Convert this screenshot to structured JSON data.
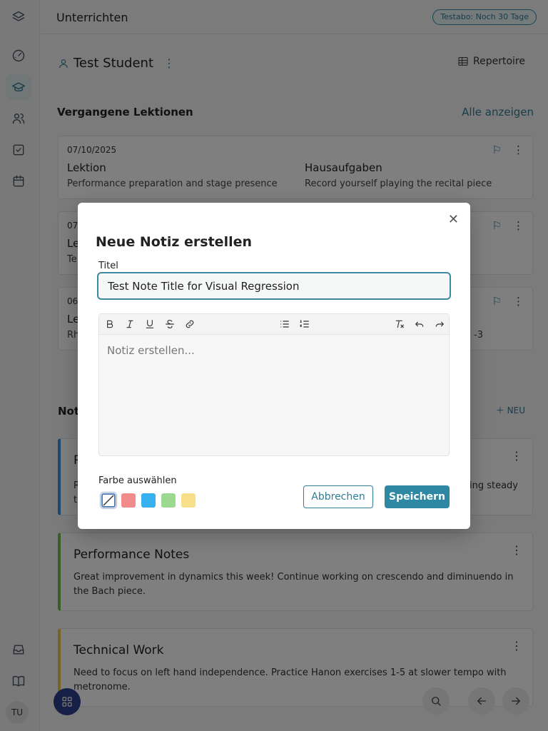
{
  "topbar": {
    "title": "Unterrichten",
    "trial_badge": "Testabo: Noch 30 Tage"
  },
  "sidebar": {
    "items": [
      {
        "icon": "layers-icon"
      },
      {
        "icon": "dashboard-icon"
      },
      {
        "icon": "graduation-cap-icon",
        "active": true
      },
      {
        "icon": "users-icon"
      },
      {
        "icon": "checkbox-icon"
      },
      {
        "icon": "calendar-icon"
      }
    ],
    "bottom": [
      {
        "icon": "inbox-icon"
      },
      {
        "icon": "book-icon"
      }
    ],
    "avatar": "TU"
  },
  "student": {
    "name": "Test Student",
    "repertoire_label": "Repertoire"
  },
  "past_lessons": {
    "title": "Vergangene Lektionen",
    "show_all": "Alle anzeigen",
    "cards": [
      {
        "date": "07/10/2025",
        "lesson_label": "Lektion",
        "lesson_text": "Performance preparation and stage presence",
        "homework_label": "Hausaufgaben",
        "homework_text": "Record yourself playing the recital piece"
      },
      {
        "date": "07/",
        "lesson_label": "Le",
        "lesson_text": "Te"
      },
      {
        "date": "06",
        "lesson_label": "Le",
        "lesson_text": "Rh",
        "homework_text": "-3"
      }
    ]
  },
  "notes": {
    "title": "Not",
    "new_label": "NEU",
    "items": [
      {
        "title": "P",
        "body_left": "R",
        "body_right": "ing steady",
        "body_line2": "t",
        "accent": "#3b8fd6"
      },
      {
        "title": "Performance Notes",
        "body": "Great improvement in dynamics this week! Continue working on crescendo and diminuendo in the Bach piece.",
        "accent": "#6bbf4e"
      },
      {
        "title": "Technical Work",
        "body": "Need to focus on left hand independence. Practice Hanon exercises 1-5 at slower tempo with metronome.",
        "accent": "#e8c94a"
      }
    ]
  },
  "modal": {
    "title": "Neue Notiz erstellen",
    "title_field_label": "Titel",
    "title_value": "Test Note Title for Visual Regression",
    "editor_placeholder": "Notiz erstellen...",
    "color_label": "Farbe auswählen",
    "colors": [
      "none",
      "#f28b8b",
      "#38b0f0",
      "#9ad98f",
      "#f8e08a"
    ],
    "selected_color": "none",
    "cancel_label": "Abbrechen",
    "save_label": "Speichern"
  }
}
